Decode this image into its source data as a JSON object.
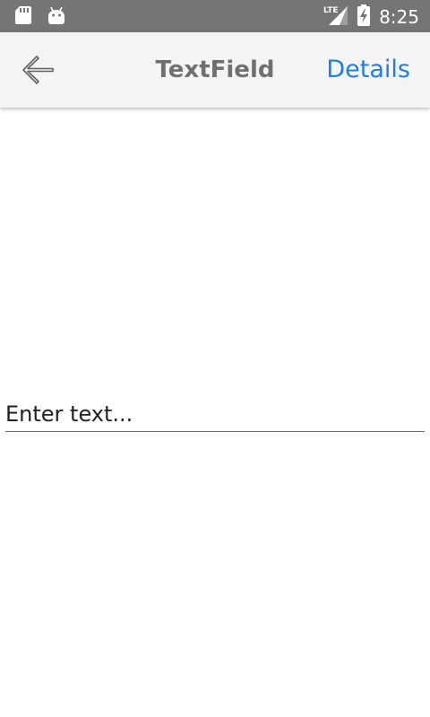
{
  "status_bar": {
    "time": "8:25",
    "network_label": "LTE",
    "icons": [
      "sd-card-icon",
      "android-icon",
      "signal-icon",
      "battery-charging-icon"
    ]
  },
  "toolbar": {
    "title": "TextField",
    "details_label": "Details",
    "back_icon": "back-arrow-icon"
  },
  "main": {
    "text_field": {
      "placeholder": "Enter text...",
      "value": ""
    }
  },
  "colors": {
    "status_bar_bg": "#757575",
    "toolbar_bg": "#f4f4f4",
    "title_color": "#707070",
    "accent": "#1e7ee4",
    "underline": "#6e6e6e"
  }
}
